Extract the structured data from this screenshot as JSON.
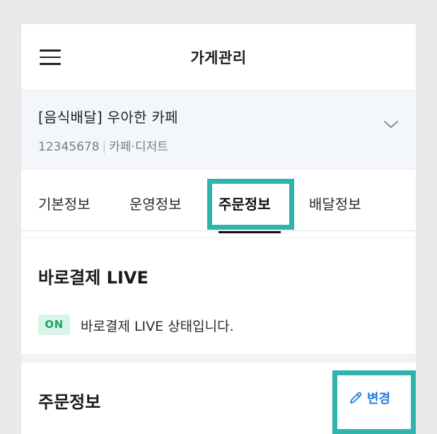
{
  "header": {
    "title": "가게관리",
    "menu_icon": "hamburger-menu-icon"
  },
  "store": {
    "name": "[음식배달] 우아한 카페",
    "id": "12345678",
    "category": "카페·디저트",
    "expand_icon": "chevron-down-icon"
  },
  "tabs": [
    {
      "label": "기본정보",
      "active": false
    },
    {
      "label": "운영정보",
      "active": false
    },
    {
      "label": "주문정보",
      "active": true
    },
    {
      "label": "배달정보",
      "active": false
    }
  ],
  "live_payment": {
    "title": "바로결제 LIVE",
    "badge": "ON",
    "status_text": "바로결제 LIVE 상태입니다."
  },
  "order_info": {
    "title": "주문정보",
    "edit_label": "변경",
    "edit_icon": "pencil-icon"
  },
  "colors": {
    "accent_blue": "#1b7de0",
    "highlight_teal": "#2fb3ad",
    "badge_green_bg": "#d9f4e6",
    "badge_green_text": "#17a664",
    "store_bg": "#f3f6fb"
  }
}
